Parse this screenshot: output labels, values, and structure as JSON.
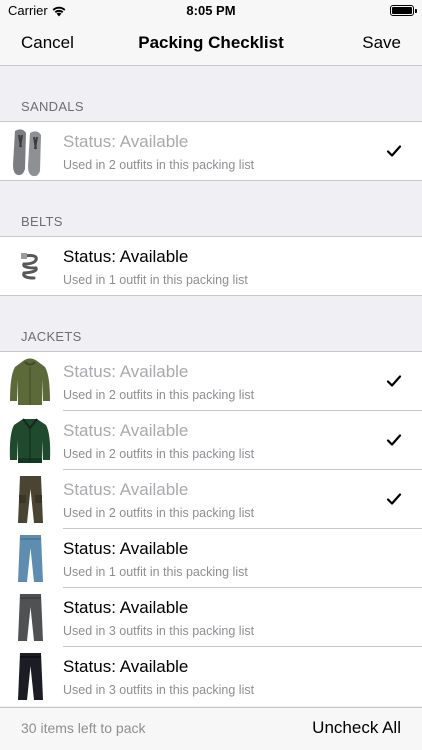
{
  "status_bar": {
    "carrier": "Carrier",
    "time": "8:05 PM"
  },
  "nav": {
    "cancel": "Cancel",
    "title": "Packing Checklist",
    "save": "Save"
  },
  "sections": [
    {
      "header": "SANDALS",
      "items": [
        {
          "icon": "sandals-icon",
          "status": "Status: Available",
          "usage": "Used in 2 outfits in this packing list",
          "checked": true
        }
      ]
    },
    {
      "header": "BELTS",
      "items": [
        {
          "icon": "belt-icon",
          "status": "Status: Available",
          "usage": "Used in 1 outfit in this packing list",
          "checked": false
        }
      ]
    },
    {
      "header": "JACKETS",
      "items": [
        {
          "icon": "olive-hoodie-icon",
          "status": "Status: Available",
          "usage": "Used in 2 outfits in this packing list",
          "checked": true
        },
        {
          "icon": "green-jacket-icon",
          "status": "Status: Available",
          "usage": "Used in 2 outfits in this packing list",
          "checked": true
        },
        {
          "icon": "cargo-pants-icon",
          "status": "Status: Available",
          "usage": "Used in 2 outfits in this packing list",
          "checked": true
        },
        {
          "icon": "blue-jeans-icon",
          "status": "Status: Available",
          "usage": "Used in 1 outfit in this packing list",
          "checked": false
        },
        {
          "icon": "grey-jeans-icon",
          "status": "Status: Available",
          "usage": "Used in 3 outfits in this packing list",
          "checked": false
        },
        {
          "icon": "black-jeans-icon",
          "status": "Status: Available",
          "usage": "Used in 3 outfits in this packing list",
          "checked": false
        }
      ]
    }
  ],
  "toolbar": {
    "items_left": "30 items left to pack",
    "uncheck_all": "Uncheck All"
  }
}
